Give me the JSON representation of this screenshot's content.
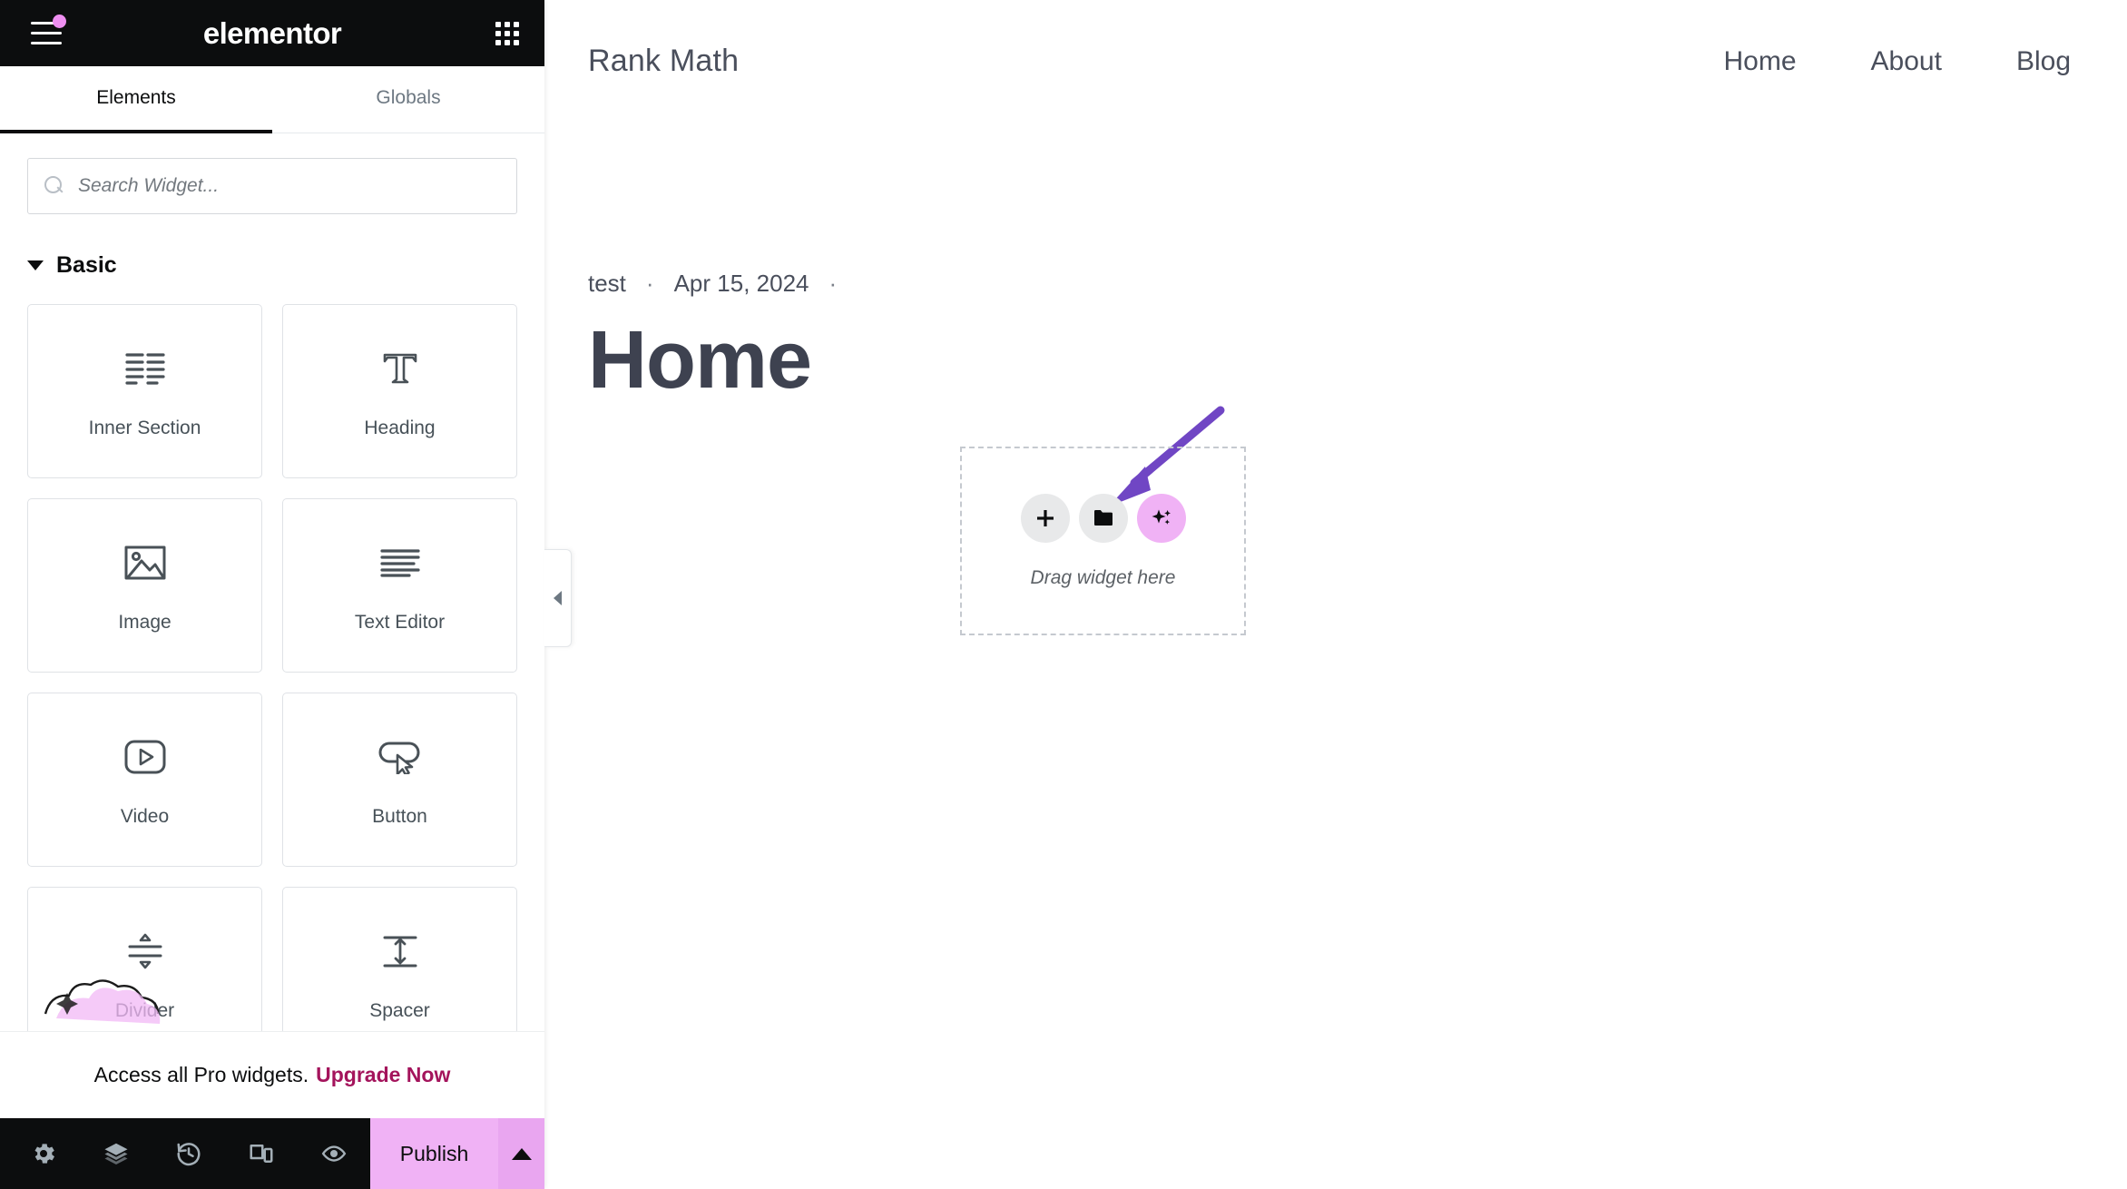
{
  "panel": {
    "brand": "elementor",
    "menu_icon": "hamburger-icon",
    "apps_icon": "apps-grid-icon",
    "tabs": [
      {
        "label": "Elements",
        "active": true
      },
      {
        "label": "Globals",
        "active": false
      }
    ],
    "search": {
      "placeholder": "Search Widget...",
      "value": "",
      "icon": "search-icon"
    },
    "category": {
      "label": "Basic",
      "expanded": true
    },
    "widgets": [
      {
        "label": "Inner Section",
        "icon": "inner-section-icon"
      },
      {
        "label": "Heading",
        "icon": "heading-t-icon"
      },
      {
        "label": "Image",
        "icon": "image-icon"
      },
      {
        "label": "Text Editor",
        "icon": "text-editor-icon"
      },
      {
        "label": "Video",
        "icon": "video-play-icon"
      },
      {
        "label": "Button",
        "icon": "button-cursor-icon"
      },
      {
        "label": "Divider",
        "icon": "divider-icon"
      },
      {
        "label": "Spacer",
        "icon": "spacer-icon"
      }
    ],
    "promo": {
      "text": "Access all Pro widgets.",
      "link": "Upgrade Now"
    },
    "footer": {
      "icons": [
        "settings-gear-icon",
        "layers-navigator-icon",
        "history-revisions-icon",
        "responsive-mode-icon",
        "preview-eye-icon"
      ],
      "publish_label": "Publish",
      "publish_caret": "chevron-up-icon"
    },
    "collapse_handle": "chevron-left-icon"
  },
  "canvas": {
    "site_logo": "Rank Math",
    "nav": [
      "Home",
      "About",
      "Blog"
    ],
    "post": {
      "author": "test",
      "separator": "·",
      "date": "Apr 15, 2024",
      "title": "Home"
    },
    "drop_zone": {
      "label": "Drag widget here",
      "buttons": [
        {
          "icon": "plus-icon",
          "style": "grey"
        },
        {
          "icon": "folder-icon",
          "style": "grey"
        },
        {
          "icon": "sparkle-ai-icon",
          "style": "pink"
        }
      ]
    },
    "annotation_arrow": {
      "color": "#7046c4",
      "points_to": "folder-icon"
    }
  },
  "colors": {
    "panel_dark": "#0c0d0e",
    "accent_pink": "#f0b2f5",
    "promo_link": "#a4145c",
    "arrow_purple": "#7046c4"
  }
}
